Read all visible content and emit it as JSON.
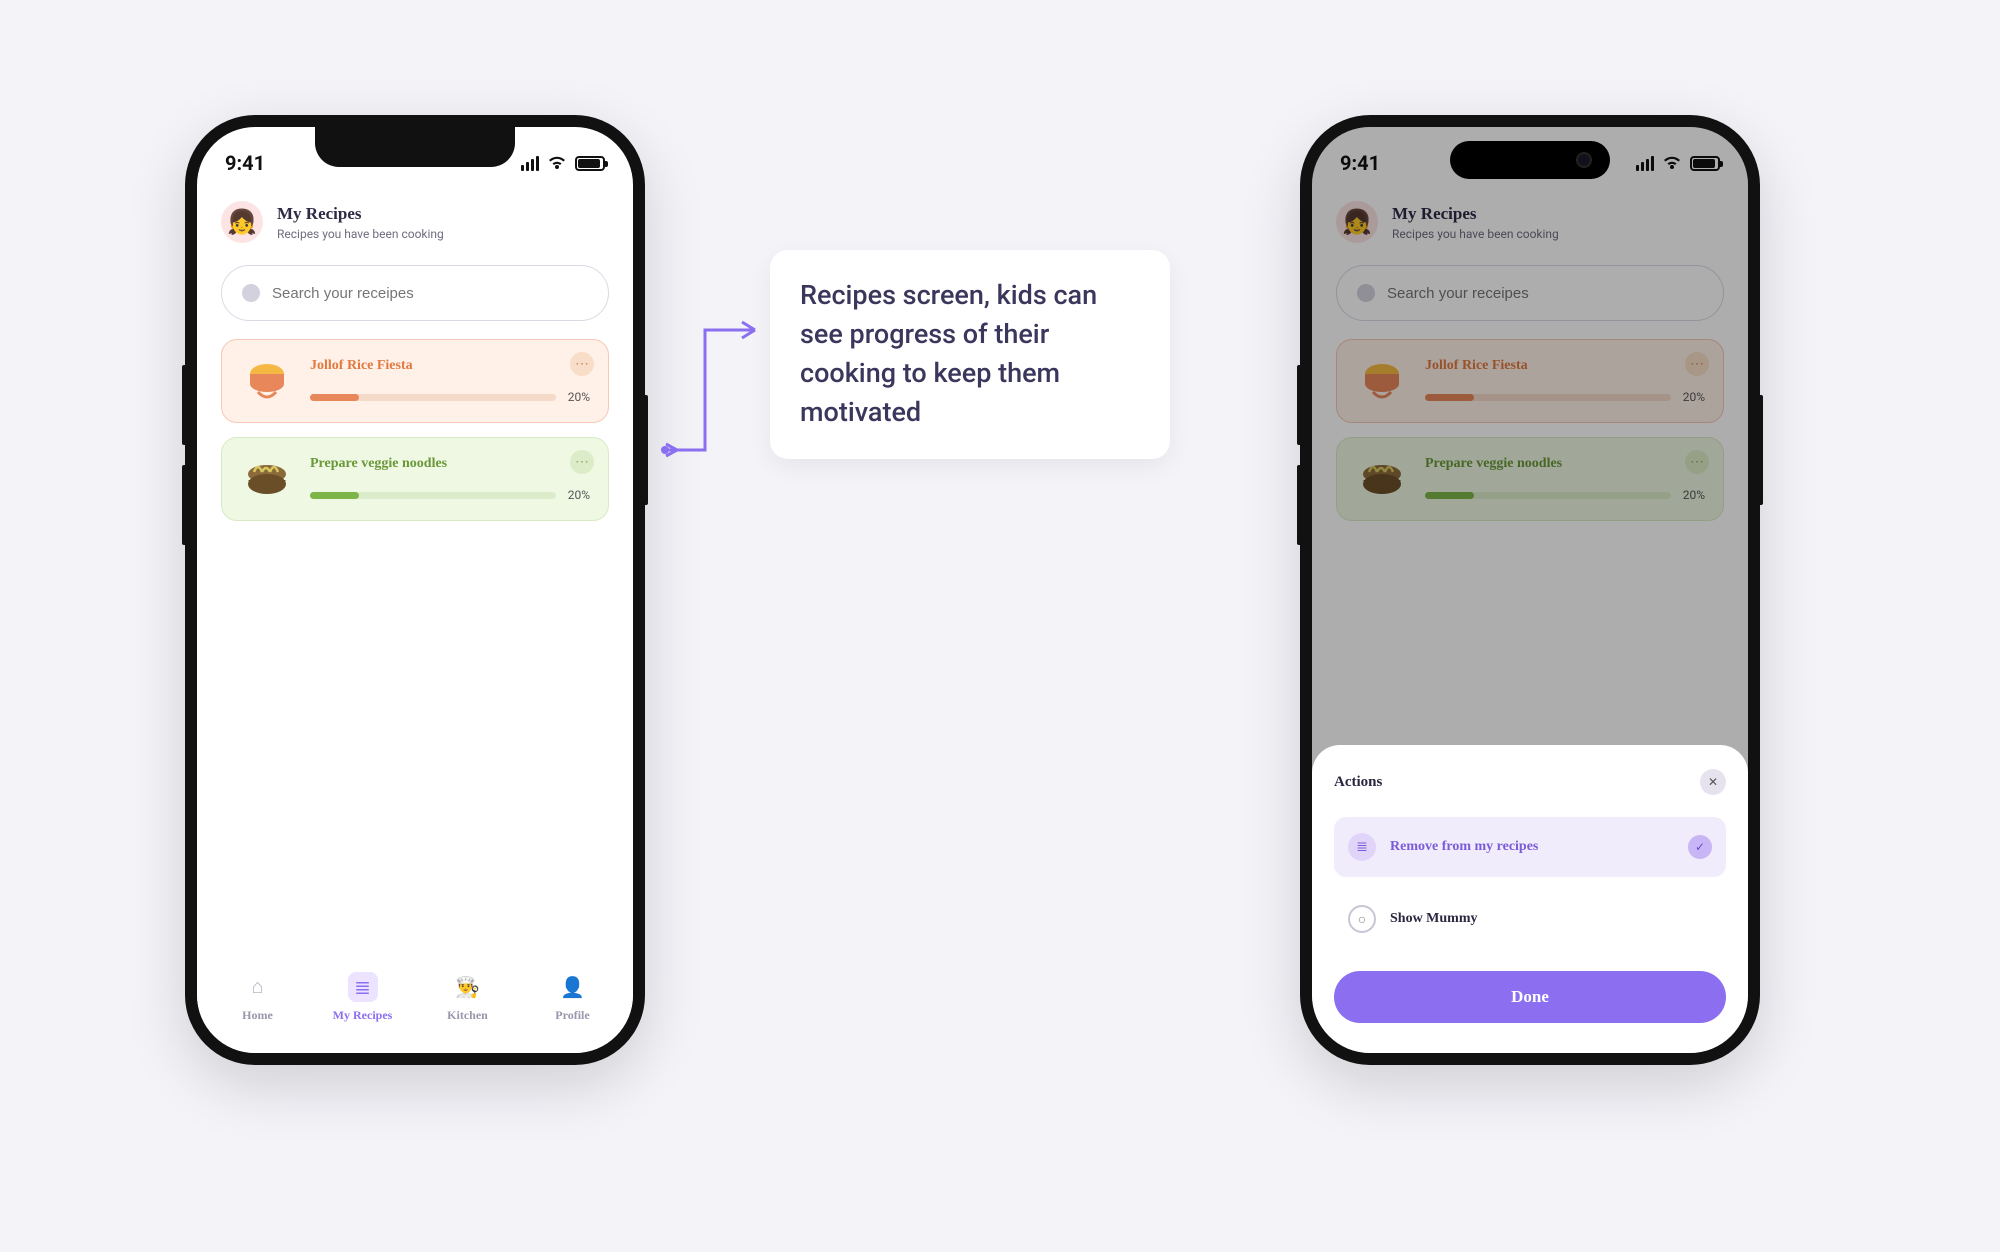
{
  "status": {
    "time": "9:41"
  },
  "header": {
    "title": "My Recipes",
    "subtitle": "Recipes you have been cooking",
    "avatar_emoji": "👧"
  },
  "search": {
    "placeholder": "Search your receipes"
  },
  "recipes": [
    {
      "title": "Jollof Rice Fiesta",
      "pct": "20%",
      "emoji": "🍛"
    },
    {
      "title": "Prepare veggie noodles",
      "pct": "20%",
      "emoji": "🍜"
    }
  ],
  "tabs": [
    {
      "label": "Home",
      "glyph": "⌂"
    },
    {
      "label": "My Recipes",
      "glyph": "≣"
    },
    {
      "label": "Kitchen",
      "glyph": "👨‍🍳"
    },
    {
      "label": "Profile",
      "glyph": "👤"
    }
  ],
  "callout": "Recipes screen, kids can see progress of their cooking to keep them motivated",
  "sheet": {
    "title": "Actions",
    "actions": [
      {
        "label": "Remove from my recipes",
        "glyph": "≣"
      },
      {
        "label": "Show Mummy",
        "glyph": "○"
      }
    ],
    "done": "Done"
  }
}
